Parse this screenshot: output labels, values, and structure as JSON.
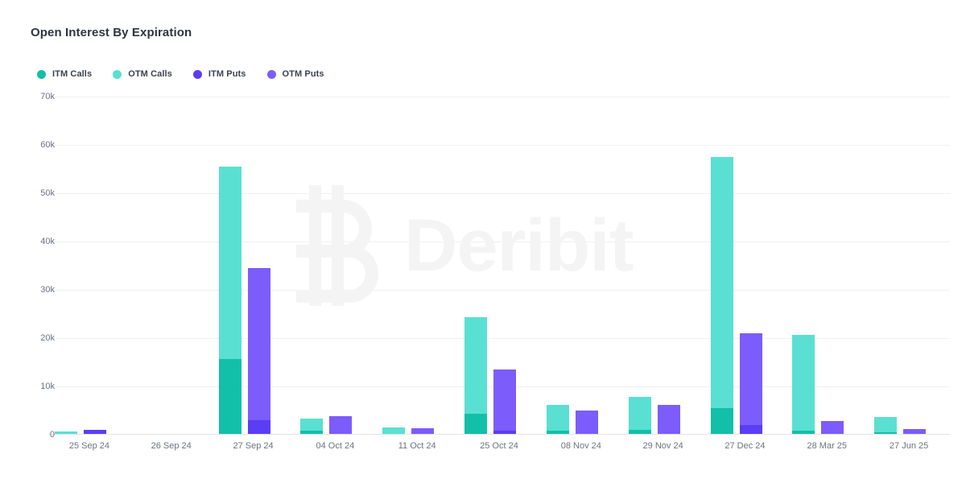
{
  "chart_data": {
    "type": "bar",
    "title": "Open Interest By Expiration",
    "subtitle": "",
    "xlabel": "",
    "ylabel": "",
    "stacked": true,
    "grouped": true,
    "grid": true,
    "legend_position": "top-left",
    "ylim": [
      0,
      70000
    ],
    "ytick_values": [
      0,
      10000,
      20000,
      30000,
      40000,
      50000,
      60000,
      70000
    ],
    "ytick_labels": [
      "0",
      "10k",
      "20k",
      "30k",
      "40k",
      "50k",
      "60k",
      "70k"
    ],
    "categories": [
      "25 Sep 24",
      "26 Sep 24",
      "27 Sep 24",
      "04 Oct 24",
      "11 Oct 24",
      "25 Oct 24",
      "08 Nov 24",
      "29 Nov 24",
      "27 Dec 24",
      "28 Mar 25",
      "27 Jun 25"
    ],
    "series": [
      {
        "name": "ITM Calls",
        "color": "#12bfa8",
        "stack": "calls",
        "values": [
          0,
          0,
          15600,
          800,
          0,
          4300,
          800,
          1000,
          5500,
          800,
          500
        ]
      },
      {
        "name": "OTM Calls",
        "color": "#59e0d2",
        "stack": "calls",
        "values": [
          600,
          0,
          39900,
          2600,
          1500,
          20000,
          5400,
          6800,
          52000,
          19800,
          3100
        ]
      },
      {
        "name": "ITM Puts",
        "color": "#5b3df5",
        "stack": "puts",
        "values": [
          1000,
          0,
          3000,
          0,
          0,
          800,
          0,
          0,
          2000,
          0,
          0
        ]
      },
      {
        "name": "OTM Puts",
        "color": "#7c5cfa",
        "stack": "puts",
        "values": [
          0,
          0,
          31500,
          3900,
          1300,
          12700,
          5000,
          6200,
          19000,
          2900,
          1200
        ]
      }
    ],
    "totals": {
      "calls": [
        600,
        0,
        55500,
        3400,
        1500,
        24300,
        6200,
        7800,
        57500,
        20600,
        3600
      ],
      "puts": [
        1000,
        0,
        34500,
        3900,
        1300,
        13500,
        5000,
        6200,
        21000,
        2900,
        1200
      ]
    }
  },
  "legend": {
    "items": [
      {
        "label": "ITM Calls",
        "color": "#12bfa8"
      },
      {
        "label": "OTM Calls",
        "color": "#59e0d2"
      },
      {
        "label": "ITM Puts",
        "color": "#5b3df5"
      },
      {
        "label": "OTM Puts",
        "color": "#7c5cfa"
      }
    ]
  },
  "watermark": {
    "text": "Deribit",
    "logo": "bitcoin-b-icon",
    "color": "#f4f4f5"
  }
}
